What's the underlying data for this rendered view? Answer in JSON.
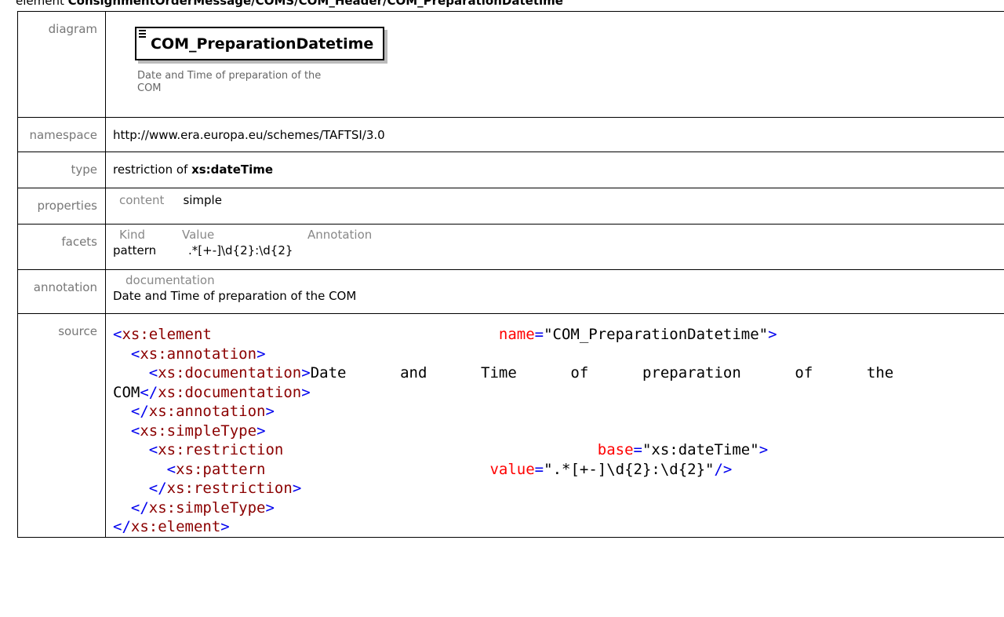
{
  "heading": {
    "prefix": "element ",
    "path": "ConsignmentOrderMessage/COMS/COM_Header/COM_PreparationDatetime"
  },
  "rows": {
    "diagram": {
      "label": "diagram",
      "element_name": "COM_PreparationDatetime",
      "doc_line1": "Date and Time of preparation of the",
      "doc_line2": "COM"
    },
    "namespace": {
      "label": "namespace",
      "value": "http://www.era.europa.eu/schemes/TAFTSI/3.0"
    },
    "type": {
      "label": "type",
      "prefix": "restriction of ",
      "base": "xs:dateTime"
    },
    "properties": {
      "label": "properties",
      "key": "content",
      "value": "simple"
    },
    "facets": {
      "label": "facets",
      "col_kind": "Kind",
      "col_value": "Value",
      "col_annotation": "Annotation",
      "kind": "pattern",
      "value": ".*[+-]\\d{2}:\\d{2}"
    },
    "annotation": {
      "label": "annotation",
      "key": "documentation",
      "text": "Date and Time of preparation of the COM"
    },
    "source": {
      "label": "source"
    }
  }
}
